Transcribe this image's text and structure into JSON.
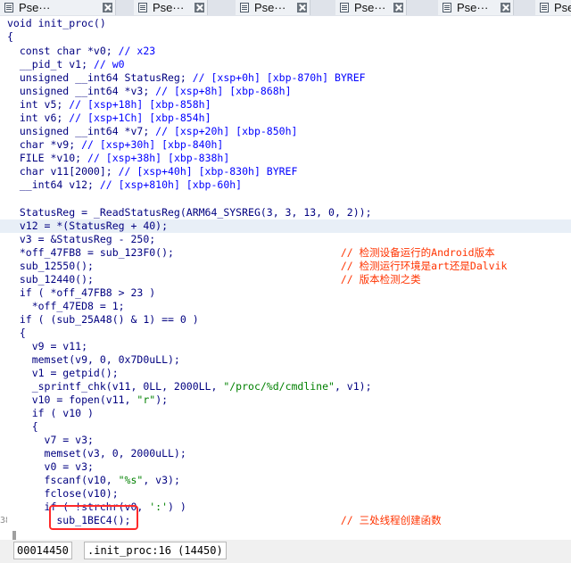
{
  "tabs": [
    {
      "label": "Pse···"
    },
    {
      "label": "Pse···"
    },
    {
      "label": "Pse···"
    },
    {
      "label": "Pse···"
    },
    {
      "label": "Pse···"
    },
    {
      "label": "Pse"
    }
  ],
  "code": {
    "func_sig": "void init_proc()",
    "open_brace": "{",
    "decl_v0": "  const char *v0; ",
    "decl_v0_c": "// x23",
    "decl_v1": "  __pid_t v1; ",
    "decl_v1_c": "// w0",
    "decl_sr": "  unsigned __int64 StatusReg; ",
    "decl_sr_c": "// [xsp+0h] [xbp-870h] BYREF",
    "decl_v3": "  unsigned __int64 *v3; ",
    "decl_v3_c": "// [xsp+8h] [xbp-868h]",
    "decl_v5": "  int v5; ",
    "decl_v5_c": "// [xsp+18h] [xbp-858h]",
    "decl_v6": "  int v6; ",
    "decl_v6_c": "// [xsp+1Ch] [xbp-854h]",
    "decl_v7": "  unsigned __int64 *v7; ",
    "decl_v7_c": "// [xsp+20h] [xbp-850h]",
    "decl_v9": "  char *v9; ",
    "decl_v9_c": "// [xsp+30h] [xbp-840h]",
    "decl_v10": "  FILE *v10; ",
    "decl_v10_c": "// [xsp+38h] [xbp-838h]",
    "decl_v11": "  char v11[2000]; ",
    "decl_v11_c": "// [xsp+40h] [xbp-830h] BYREF",
    "decl_v12": "  __int64 v12; ",
    "decl_v12_c": "// [xsp+810h] [xbp-60h]",
    "s1": "  StatusReg = _ReadStatusReg(ARM64_SYSREG(3, 3, 13, 0, 2));",
    "s2": "  v12 = *(StatusReg + 40);",
    "s3": "  v3 = &StatusReg - 250;",
    "s4": "  *off_47FB8 = sub_123F0();                           ",
    "s4_c": "// 检测设备运行的Android版本",
    "s5": "  sub_12550();                                        ",
    "s5_c": "// 检测运行环境是art还是Dalvik",
    "s6": "  sub_12440();                                        ",
    "s6_c": "// 版本检测之类",
    "s7": "  if ( *off_47FB8 > 23 )",
    "s8": "    *off_47ED8 = 1;",
    "s9": "  if ( (sub_25A48() & 1) == 0 )",
    "s10": "  {",
    "s11": "    v9 = v11;",
    "s12": "    memset(v9, 0, 0x7D0uLL);",
    "s13": "    v1 = getpid();",
    "s14a": "    _sprintf_chk(v11, 0LL, 2000LL, ",
    "s14s": "\"/proc/%d/cmdline\"",
    "s14b": ", v1);",
    "s15a": "    v10 = fopen(v11, ",
    "s15s": "\"r\"",
    "s15b": ");",
    "s16": "    if ( v10 )",
    "s17": "    {",
    "s18": "      v7 = v3;",
    "s19": "      memset(v3, 0, 2000uLL);",
    "s20": "      v0 = v3;",
    "s21a": "      fscanf(v10, ",
    "s21s": "\"%s\"",
    "s21b": ", v3);",
    "s22": "      fclose(v10);",
    "s23a": "      if ( !strchr(v0, ",
    "s23s": "':'",
    "s23b": ") )",
    "s24": "        sub_1BEC4();                                  ",
    "s24_c": "// 三处线程创建函数",
    "ln_s24": "38"
  },
  "status": {
    "address": "00014450",
    "location": ".init_proc:16 (14450)"
  },
  "colors": {
    "keyword": "#000080",
    "comment": "#0000ff",
    "string": "#008000",
    "annotation_comment": "#ff3300",
    "highlight_box": "#ff2a2a"
  },
  "icons": [
    "pseudocode-tab-icon",
    "close-tab-icon"
  ]
}
